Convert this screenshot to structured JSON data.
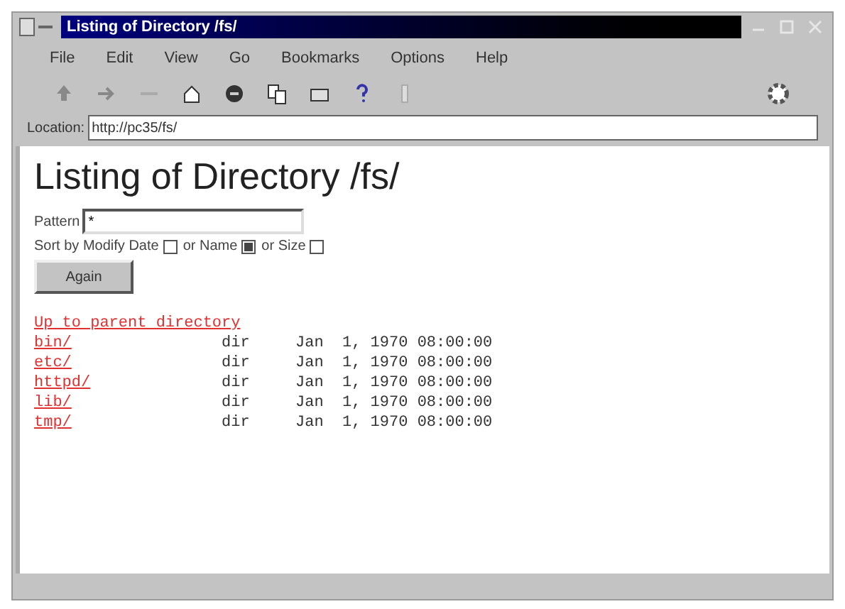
{
  "window": {
    "title": "Listing of Directory /fs/"
  },
  "menu": [
    "File",
    "Edit",
    "View",
    "Go",
    "Bookmarks",
    "Options",
    "Help"
  ],
  "location": {
    "label": "Location:",
    "value": "http://pc35/fs/"
  },
  "page": {
    "heading": "Listing of Directory /fs/",
    "pattern": {
      "label": "Pattern",
      "value": "*"
    },
    "sort": [
      {
        "label": "Sort by Modify Date",
        "checked": false
      },
      {
        "label": "or Name",
        "checked": true
      },
      {
        "label": "or Size",
        "checked": false
      }
    ],
    "button": "Again",
    "parent_link": "Up to parent directory",
    "entries": [
      {
        "name": "bin/",
        "type": "dir",
        "date": "Jan  1, 1970 08:00:00"
      },
      {
        "name": "etc/",
        "type": "dir",
        "date": "Jan  1, 1970 08:00:00"
      },
      {
        "name": "httpd/",
        "type": "dir",
        "date": "Jan  1, 1970 08:00:00"
      },
      {
        "name": "lib/",
        "type": "dir",
        "date": "Jan  1, 1970 08:00:00"
      },
      {
        "name": "tmp/",
        "type": "dir",
        "date": "Jan  1, 1970 08:00:00"
      }
    ]
  }
}
